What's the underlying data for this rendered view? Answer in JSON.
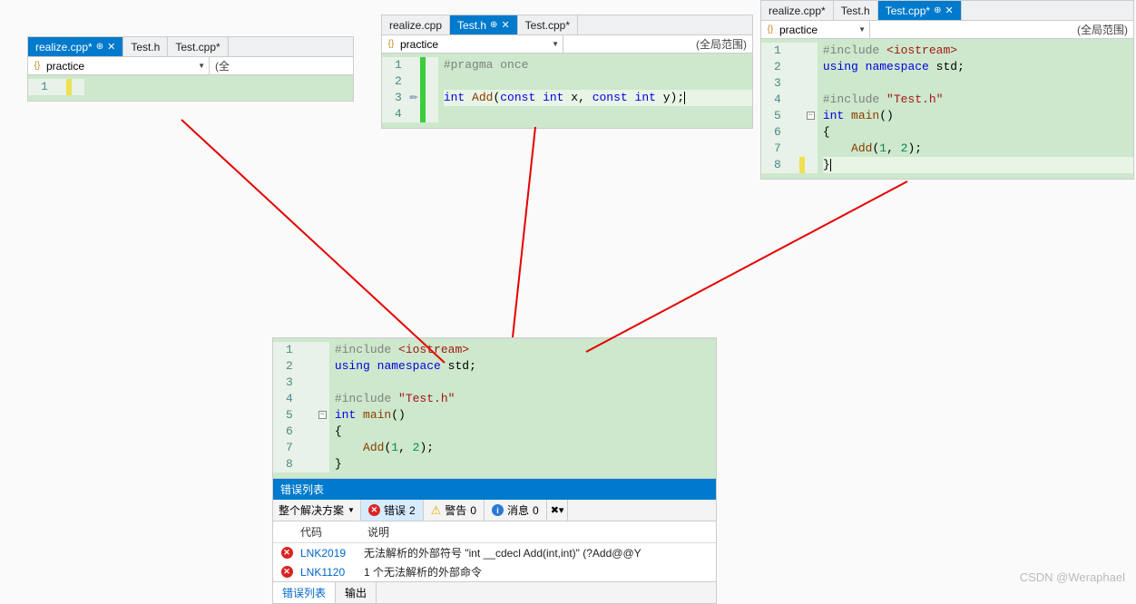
{
  "watermark": "CSDN @Weraphael",
  "pane1": {
    "tabs": [
      {
        "label": "realize.cpp*",
        "active": true,
        "pinned": true,
        "closable": true
      },
      {
        "label": "Test.h",
        "active": false
      },
      {
        "label": "Test.cpp*",
        "active": false
      }
    ],
    "scope": "practice",
    "scope_right": "(全",
    "lines": [
      {
        "n": 1,
        "mark": "yellow",
        "tokens": []
      }
    ]
  },
  "pane2": {
    "tabs": [
      {
        "label": "realize.cpp",
        "active": false
      },
      {
        "label": "Test.h",
        "active": true,
        "pinned": true,
        "closable": true
      },
      {
        "label": "Test.cpp*",
        "active": false
      }
    ],
    "scope": "practice",
    "scope_right": "(全局范围)",
    "lines": [
      {
        "n": 1,
        "mark": "green",
        "tokens": [
          {
            "t": "#pragma once",
            "c": "dir"
          }
        ]
      },
      {
        "n": 2,
        "mark": "green",
        "tokens": []
      },
      {
        "n": 3,
        "mark": "green",
        "hl": true,
        "pencil": true,
        "tokens": [
          {
            "t": "int",
            "c": "ty"
          },
          {
            "t": " "
          },
          {
            "t": "Add",
            "c": "fn"
          },
          {
            "t": "("
          },
          {
            "t": "const",
            "c": "kw"
          },
          {
            "t": " "
          },
          {
            "t": "int",
            "c": "ty"
          },
          {
            "t": " x, "
          },
          {
            "t": "const",
            "c": "kw"
          },
          {
            "t": " "
          },
          {
            "t": "int",
            "c": "ty"
          },
          {
            "t": " y);"
          }
        ],
        "cursor": true
      },
      {
        "n": 4,
        "mark": "green",
        "tokens": []
      }
    ]
  },
  "pane3": {
    "tabs": [
      {
        "label": "realize.cpp*",
        "active": false
      },
      {
        "label": "Test.h",
        "active": false
      },
      {
        "label": "Test.cpp*",
        "active": true,
        "pinned": true,
        "closable": true
      }
    ],
    "scope": "practice",
    "scope_right": "(全局范围)",
    "lines": [
      {
        "n": 1,
        "mark": "none",
        "tokens": [
          {
            "t": "#include ",
            "c": "dir"
          },
          {
            "t": "<iostream>",
            "c": "str"
          }
        ]
      },
      {
        "n": 2,
        "mark": "none",
        "tokens": [
          {
            "t": "using",
            "c": "kw"
          },
          {
            "t": " "
          },
          {
            "t": "namespace",
            "c": "kw"
          },
          {
            "t": " std;"
          }
        ]
      },
      {
        "n": 3,
        "mark": "none",
        "tokens": []
      },
      {
        "n": 4,
        "mark": "none",
        "tokens": [
          {
            "t": "#include ",
            "c": "dir"
          },
          {
            "t": "\"Test.h\"",
            "c": "str"
          }
        ]
      },
      {
        "n": 5,
        "mark": "none",
        "outline": "-",
        "tokens": [
          {
            "t": "int",
            "c": "ty"
          },
          {
            "t": " "
          },
          {
            "t": "main",
            "c": "fn"
          },
          {
            "t": "()"
          }
        ]
      },
      {
        "n": 6,
        "mark": "none",
        "tokens": [
          {
            "t": "{"
          }
        ]
      },
      {
        "n": 7,
        "mark": "none",
        "tokens": [
          {
            "t": "    "
          },
          {
            "t": "Add",
            "c": "fn"
          },
          {
            "t": "("
          },
          {
            "t": "1",
            "c": "num"
          },
          {
            "t": ", "
          },
          {
            "t": "2",
            "c": "num"
          },
          {
            "t": ");"
          }
        ]
      },
      {
        "n": 8,
        "mark": "yellow",
        "hl": true,
        "tokens": [
          {
            "t": "}"
          }
        ],
        "cursor": true
      }
    ]
  },
  "pane4": {
    "lines": [
      {
        "n": 1,
        "mark": "none",
        "tokens": [
          {
            "t": "#include ",
            "c": "dir"
          },
          {
            "t": "<iostream>",
            "c": "str"
          }
        ]
      },
      {
        "n": 2,
        "mark": "none",
        "tokens": [
          {
            "t": "using",
            "c": "kw"
          },
          {
            "t": " "
          },
          {
            "t": "namespace",
            "c": "kw"
          },
          {
            "t": " std;"
          }
        ]
      },
      {
        "n": 3,
        "mark": "none",
        "tokens": []
      },
      {
        "n": 4,
        "mark": "none",
        "tokens": [
          {
            "t": "#include ",
            "c": "dir"
          },
          {
            "t": "\"Test.h\"",
            "c": "str"
          }
        ]
      },
      {
        "n": 5,
        "mark": "none",
        "outline": "-",
        "tokens": [
          {
            "t": "int",
            "c": "ty"
          },
          {
            "t": " "
          },
          {
            "t": "main",
            "c": "fn"
          },
          {
            "t": "()"
          }
        ]
      },
      {
        "n": 6,
        "mark": "none",
        "tokens": [
          {
            "t": "{"
          }
        ]
      },
      {
        "n": 7,
        "mark": "none",
        "tokens": [
          {
            "t": "    "
          },
          {
            "t": "Add",
            "c": "fn"
          },
          {
            "t": "("
          },
          {
            "t": "1",
            "c": "num"
          },
          {
            "t": ", "
          },
          {
            "t": "2",
            "c": "num"
          },
          {
            "t": ");"
          }
        ]
      },
      {
        "n": 8,
        "mark": "none",
        "tokens": [
          {
            "t": "}"
          }
        ]
      }
    ],
    "errorpanel": {
      "title": "错误列表",
      "solution_scope": "整个解决方案",
      "errors_label": "错误",
      "errors_count": 2,
      "warnings_label": "警告",
      "warnings_count": 0,
      "messages_label": "消息",
      "messages_count": 0,
      "cols": {
        "code": "代码",
        "desc": "说明"
      },
      "rows": [
        {
          "code": "LNK2019",
          "desc": "无法解析的外部符号 \"int __cdecl Add(int,int)\" (?Add@@Y"
        },
        {
          "code": "LNK1120",
          "desc": "1 个无法解析的外部命令"
        }
      ],
      "bottom_tabs": [
        {
          "label": "错误列表",
          "active": true
        },
        {
          "label": "输出",
          "active": false
        }
      ]
    }
  }
}
